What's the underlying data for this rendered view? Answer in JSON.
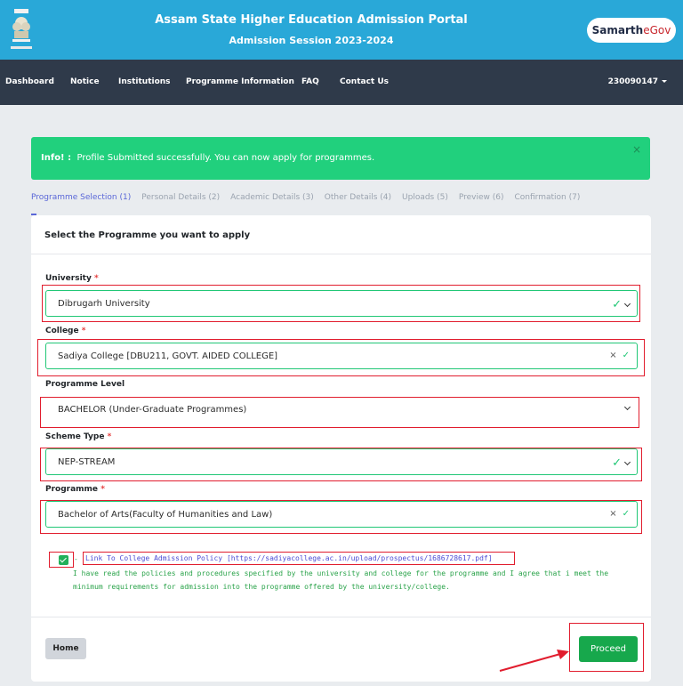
{
  "header": {
    "title": "Assam State Higher Education Admission Portal",
    "subtitle": "Admission Session 2023-2024",
    "brand_main": "Samarth",
    "brand_accent": "eGov",
    "emblem_icon": "national-emblem-icon",
    "colors": {
      "topbar": "#29a8d8",
      "navbar": "#2f3a4a"
    }
  },
  "nav": {
    "items": [
      "Dashboard",
      "Notice",
      "Institutions",
      "Programme Information",
      "FAQ",
      "Contact Us"
    ],
    "user": "230090147"
  },
  "alert": {
    "prefix": "Info! :",
    "message": "Profile Submitted successfully. You can now apply for programmes.",
    "close": "×",
    "color": "#21d07d"
  },
  "steps": [
    "Programme Selection (1)",
    "Personal Details (2)",
    "Academic Details (3)",
    "Other Details (4)",
    "Uploads (5)",
    "Preview (6)",
    "Confirmation (7)"
  ],
  "form": {
    "heading": "Select the Programme you want to apply",
    "fields": [
      {
        "label": "University",
        "required": "*",
        "value": "Dibrugarh University"
      },
      {
        "label": "College",
        "required": "*",
        "value": "Sadiya College [DBU211, GOVT. AIDED COLLEGE]"
      },
      {
        "label": "Programme Level",
        "required": "",
        "value": "BACHELOR (Under-Graduate Programmes)"
      },
      {
        "label": "Scheme Type",
        "required": "*",
        "value": "NEP-STREAM"
      },
      {
        "label": "Programme",
        "required": "*",
        "value": "Bachelor of Arts(Faculty of Humanities and Law)"
      }
    ],
    "declaration": {
      "dash": "-",
      "link_text": "Link To College Admission Policy [https://sadiyacollege.ac.in/upload/prospectus/1686728617.pdf]",
      "agreement": "I have read the policies and procedures specified by the university and college for the programme and I agree that i meet the minimum requirements for admission into the programme offered by the university/college."
    }
  },
  "buttons": {
    "home": "Home",
    "proceed": "Proceed"
  },
  "annotation_color": "#e11d2e"
}
